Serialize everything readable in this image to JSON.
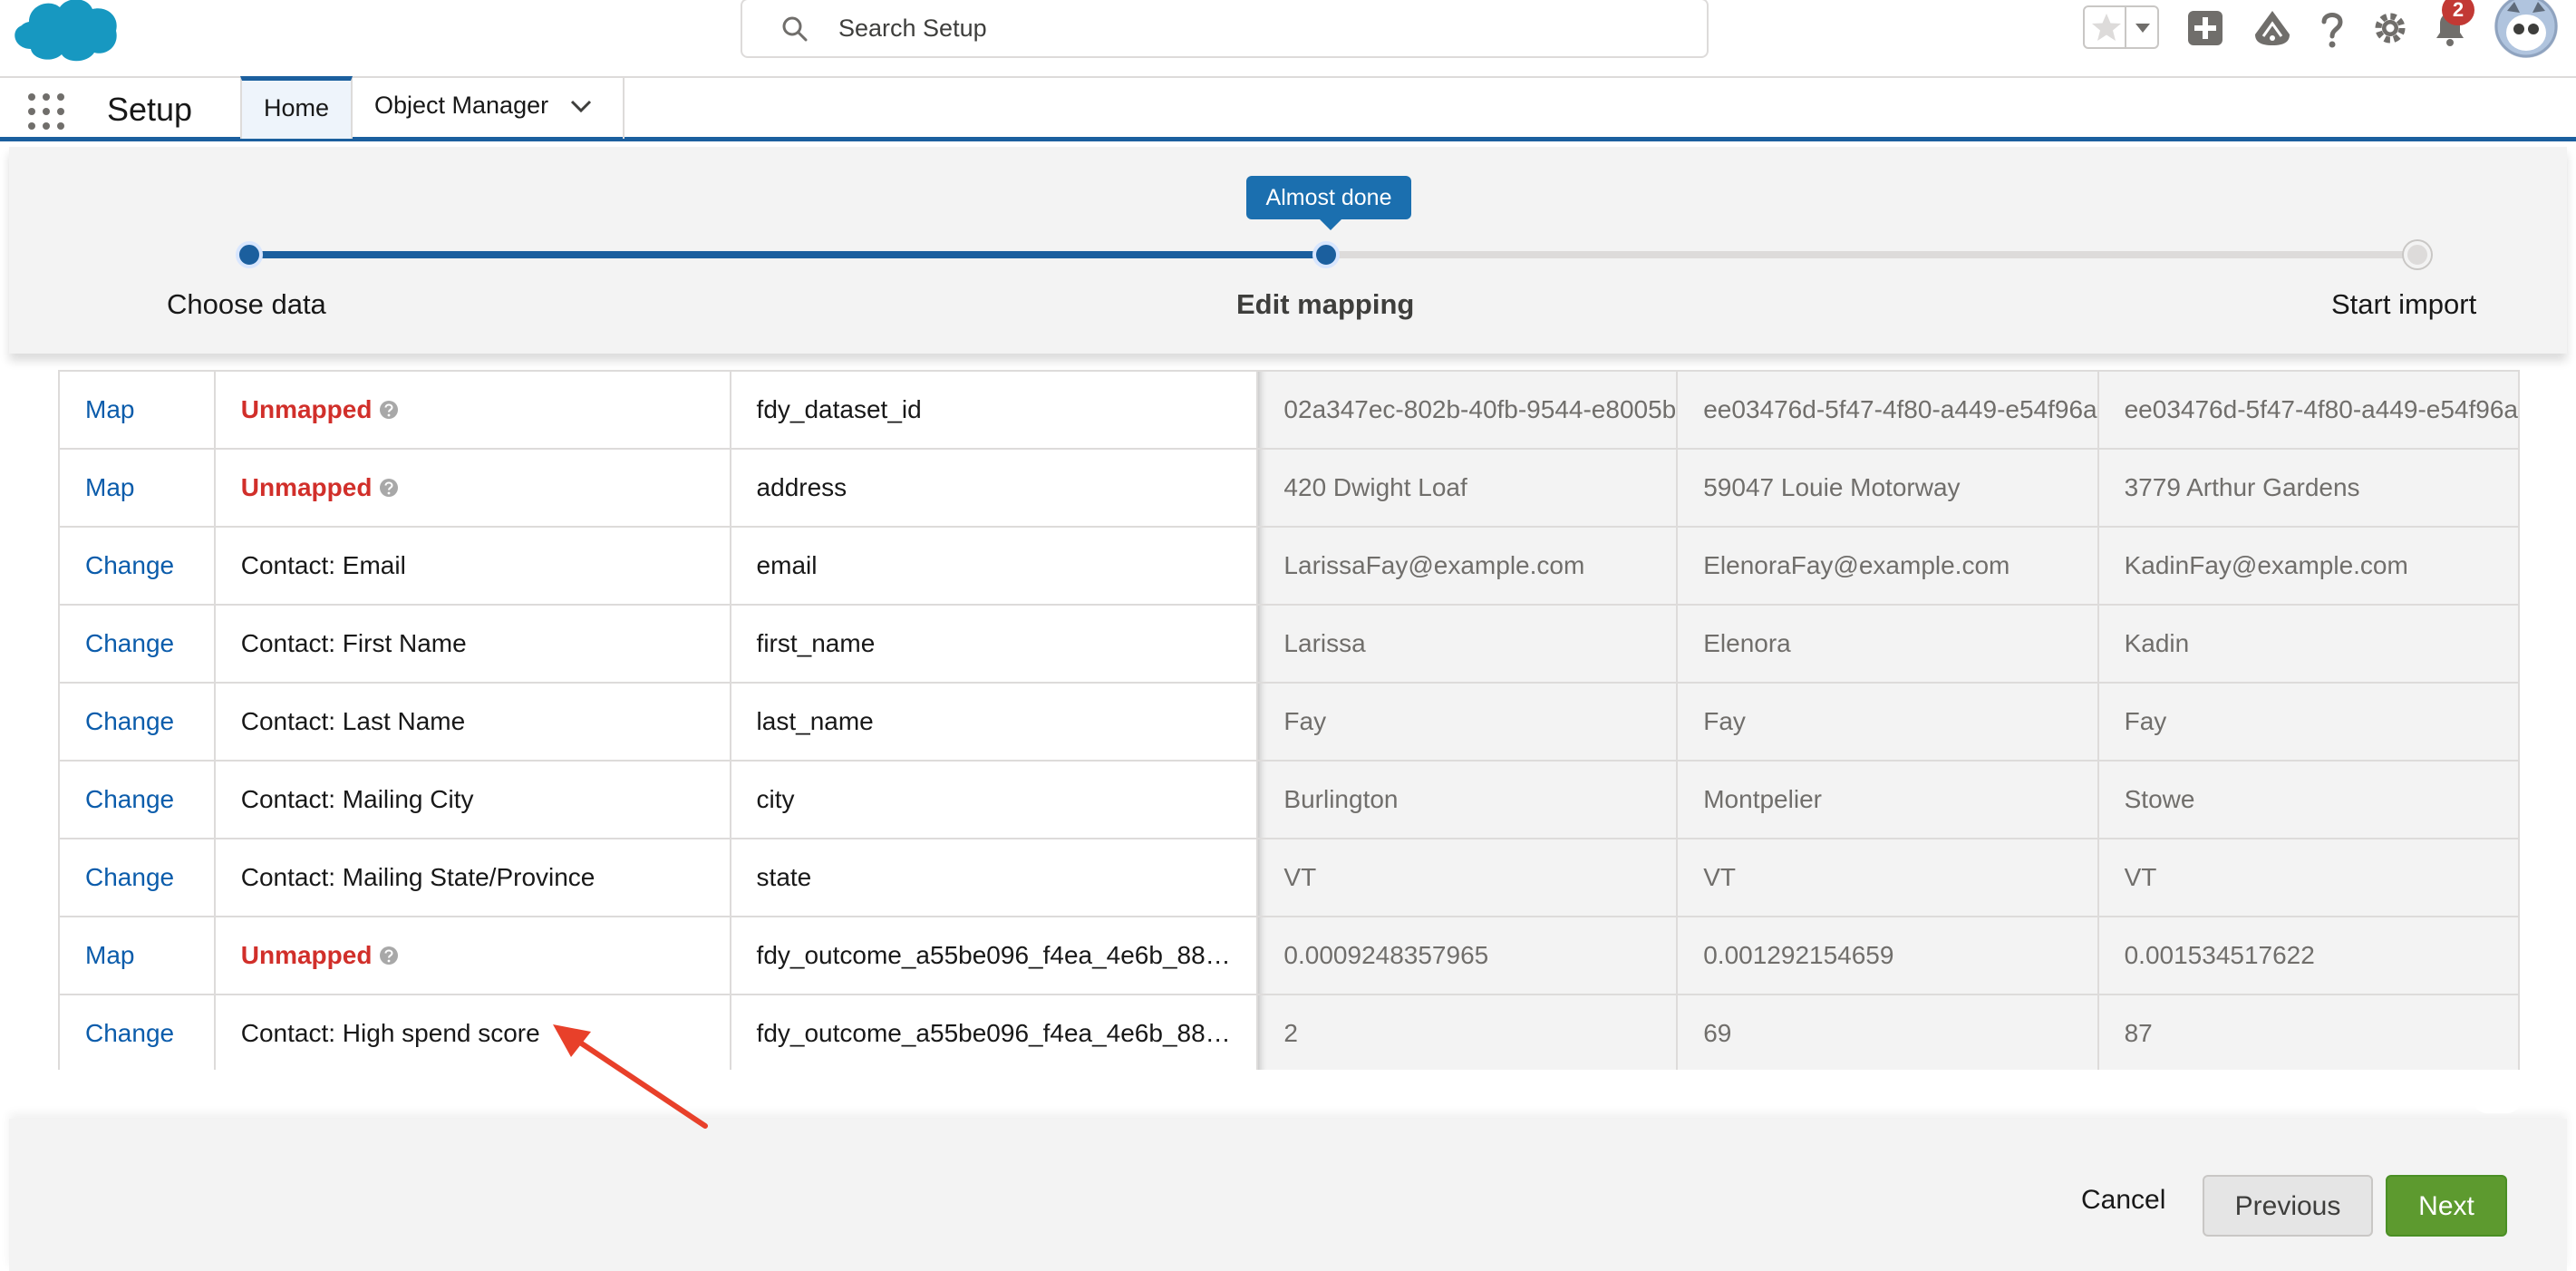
{
  "header": {
    "search_placeholder": "Search Setup",
    "notification_count": "2",
    "icons": [
      "salesforce-cloud-logo",
      "search-icon",
      "star-icon",
      "caret-down-icon",
      "plus-icon",
      "trailhead-icon",
      "help-icon",
      "gear-icon",
      "bell-icon",
      "avatar-icon"
    ]
  },
  "context_bar": {
    "app_name": "Setup",
    "tabs": [
      {
        "label": "Home",
        "active": true
      },
      {
        "label": "Object Manager",
        "active": false
      }
    ]
  },
  "progress": {
    "tooltip": "Almost done",
    "steps": [
      {
        "label": "Choose data",
        "state": "complete"
      },
      {
        "label": "Edit mapping",
        "state": "current"
      },
      {
        "label": "Start import",
        "state": "upcoming"
      }
    ]
  },
  "table": {
    "rows": [
      {
        "action": "Map",
        "field": "Unmapped",
        "unmapped": true,
        "column": "fdy_dataset_id",
        "samples": [
          "02a347ec-802b-40fb-9544-e8005b",
          "ee03476d-5f47-4f80-a449-e54f96a",
          "ee03476d-5f47-4f80-a449-e54f96a"
        ]
      },
      {
        "action": "Map",
        "field": "Unmapped",
        "unmapped": true,
        "column": "address",
        "samples": [
          "420 Dwight Loaf",
          "59047 Louie Motorway",
          "3779 Arthur Gardens"
        ]
      },
      {
        "action": "Change",
        "field": "Contact: Email",
        "unmapped": false,
        "column": "email",
        "samples": [
          "LarissaFay@example.com",
          "ElenoraFay@example.com",
          "KadinFay@example.com"
        ]
      },
      {
        "action": "Change",
        "field": "Contact: First Name",
        "unmapped": false,
        "column": "first_name",
        "samples": [
          "Larissa",
          "Elenora",
          "Kadin"
        ]
      },
      {
        "action": "Change",
        "field": "Contact: Last Name",
        "unmapped": false,
        "column": "last_name",
        "samples": [
          "Fay",
          "Fay",
          "Fay"
        ]
      },
      {
        "action": "Change",
        "field": "Contact: Mailing City",
        "unmapped": false,
        "column": "city",
        "samples": [
          "Burlington",
          "Montpelier",
          "Stowe"
        ]
      },
      {
        "action": "Change",
        "field": "Contact: Mailing State/Province",
        "unmapped": false,
        "column": "state",
        "samples": [
          "VT",
          "VT",
          "VT"
        ]
      },
      {
        "action": "Map",
        "field": "Unmapped",
        "unmapped": true,
        "column": "fdy_outcome_a55be096_f4ea_4e6b_88…",
        "samples": [
          "0.0009248357965",
          "0.001292154659",
          "0.001534517622"
        ]
      },
      {
        "action": "Change",
        "field": "Contact: High spend score",
        "unmapped": false,
        "column": "fdy_outcome_a55be096_f4ea_4e6b_88…",
        "samples": [
          "2",
          "69",
          "87"
        ]
      }
    ]
  },
  "footer": {
    "cancel_label": "Cancel",
    "previous_label": "Previous",
    "next_label": "Next"
  },
  "colors": {
    "brand_blue": "#1b5f9e",
    "link_blue": "#0b5cab",
    "unmapped_red": "#d12f2a",
    "next_green": "#5d9a2f",
    "annotation_arrow": "#e8402a"
  }
}
